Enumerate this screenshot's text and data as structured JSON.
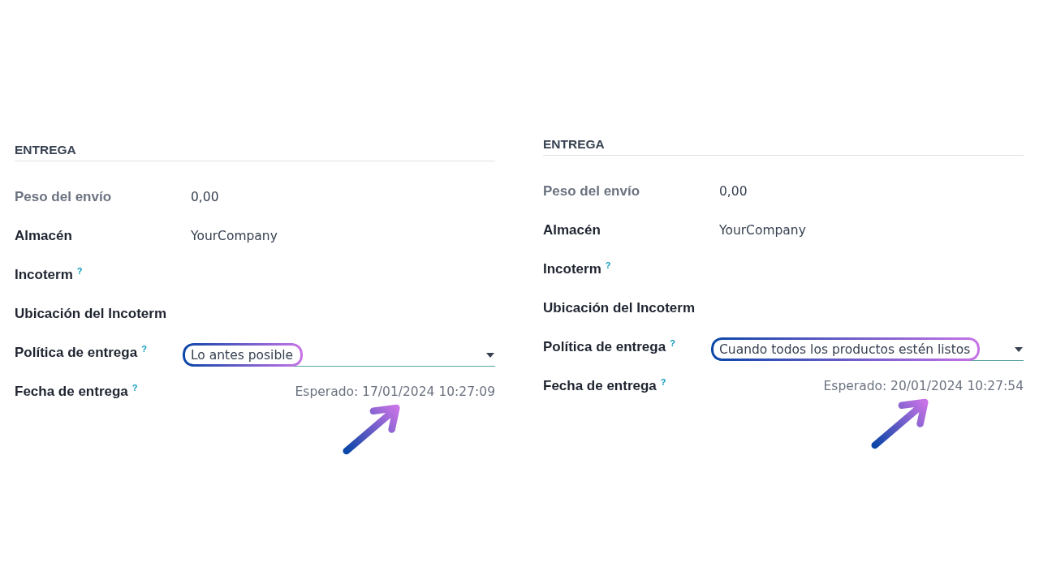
{
  "panels": [
    {
      "section_title": "ENTREGA",
      "fields": [
        {
          "kind": "text",
          "label": "Peso del envío",
          "muted": true,
          "value": "0,00",
          "highlighted": false,
          "arrow": false
        },
        {
          "kind": "text",
          "label": "Almacén",
          "muted": false,
          "value": "YourCompany",
          "highlighted": false,
          "arrow": false
        },
        {
          "kind": "text",
          "label": "Incoterm",
          "help": "?",
          "muted": false,
          "highlighted": false,
          "arrow": false
        },
        {
          "kind": "text",
          "label": "Ubicación del Incoterm",
          "muted": false,
          "highlighted": false,
          "arrow": false
        },
        {
          "kind": "select",
          "label": "Política de entrega",
          "help": "?",
          "muted": false,
          "value": "Lo antes posible",
          "highlighted": true,
          "arrow": false
        },
        {
          "kind": "date",
          "label": "Fecha de entrega",
          "help": "?",
          "muted": false,
          "value": "Esperado: 17/01/2024 10:27:09",
          "highlighted": false,
          "arrow": true
        }
      ]
    },
    {
      "section_title": "ENTREGA",
      "fields": [
        {
          "kind": "text",
          "label": "Peso del envío",
          "muted": true,
          "value": "0,00",
          "highlighted": false,
          "arrow": false
        },
        {
          "kind": "text",
          "label": "Almacén",
          "muted": false,
          "value": "YourCompany",
          "highlighted": false,
          "arrow": false
        },
        {
          "kind": "text",
          "label": "Incoterm",
          "help": "?",
          "muted": false,
          "highlighted": false,
          "arrow": false
        },
        {
          "kind": "text",
          "label": "Ubicación del Incoterm",
          "muted": false,
          "highlighted": false,
          "arrow": false
        },
        {
          "kind": "select",
          "label": "Política de entrega",
          "help": "?",
          "muted": false,
          "value": "Cuando todos los productos estén listos",
          "highlighted": true,
          "arrow": false
        },
        {
          "kind": "date",
          "label": "Fecha de entrega",
          "help": "?",
          "muted": false,
          "value": "Esperado: 20/01/2024 10:27:54",
          "highlighted": false,
          "arrow": true
        }
      ]
    }
  ]
}
